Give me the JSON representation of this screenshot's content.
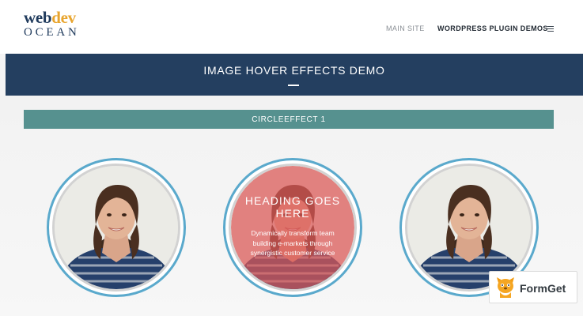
{
  "header": {
    "logo": {
      "word1": "web",
      "word2": "dev",
      "word3": "OCEAN"
    },
    "nav": [
      {
        "label": "MAIN SITE"
      },
      {
        "label": "WORDPRESS PLUGIN DEMOS"
      }
    ],
    "menu_icon": "hamburger-menu-icon"
  },
  "hero": {
    "title": "IMAGE HOVER EFFECTS DEMO"
  },
  "section": {
    "title": "CIRCLEEFFECT 1"
  },
  "cards": [
    {
      "state": "normal"
    },
    {
      "state": "hover",
      "heading_line1": "HEADING GOES",
      "heading_line2": "HERE",
      "text_line1": "Dynamically transform team",
      "text_line2": "building e-markets through",
      "text_line3": "synergistic customer service"
    },
    {
      "state": "normal"
    }
  ],
  "badge": {
    "label": "FormGet",
    "icon": "formget-logo-icon"
  },
  "colors": {
    "navy": "#243f60",
    "gold": "#e8a52f",
    "teal": "#56918f",
    "circle_border": "#5aa9cc",
    "overlay": "#dc5858",
    "shirt_blue": "#26406b"
  }
}
